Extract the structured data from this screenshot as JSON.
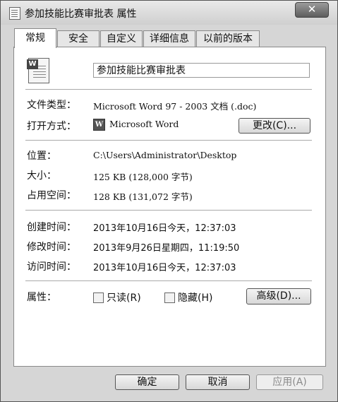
{
  "window": {
    "title": "参加技能比赛审批表 属性",
    "close_icon": "✕"
  },
  "tabs": [
    {
      "label": "常规"
    },
    {
      "label": "安全"
    },
    {
      "label": "自定义"
    },
    {
      "label": "详细信息"
    },
    {
      "label": "以前的版本"
    }
  ],
  "file": {
    "name": "参加技能比赛审批表",
    "icon_letter": "W"
  },
  "props": {
    "type_label": "文件类型：",
    "type_value": "Microsoft Word 97 - 2003 文档 (.doc)",
    "open_label": "打开方式：",
    "open_value": "Microsoft Word",
    "change_button": "更改(C)...",
    "location_label": "位置：",
    "location_value": "C:\\Users\\Administrator\\Desktop",
    "size_label": "大小：",
    "size_value": "125 KB (128,000 字节)",
    "disk_label": "占用空间：",
    "disk_value": "128 KB (131,072 字节)",
    "created_label": "创建时间：",
    "created_value": "2013年10月16日今天，12:37:03",
    "modified_label": "修改时间：",
    "modified_value": "2013年9月26日星期四，11:19:50",
    "accessed_label": "访问时间：",
    "accessed_value": "2013年10月16日今天，12:37:03",
    "attr_label": "属性：",
    "readonly_label": "只读(R)",
    "hidden_label": "隐藏(H)",
    "advanced_button": "高级(D)..."
  },
  "footer": {
    "ok": "确定",
    "cancel": "取消",
    "apply": "应用(A)"
  }
}
